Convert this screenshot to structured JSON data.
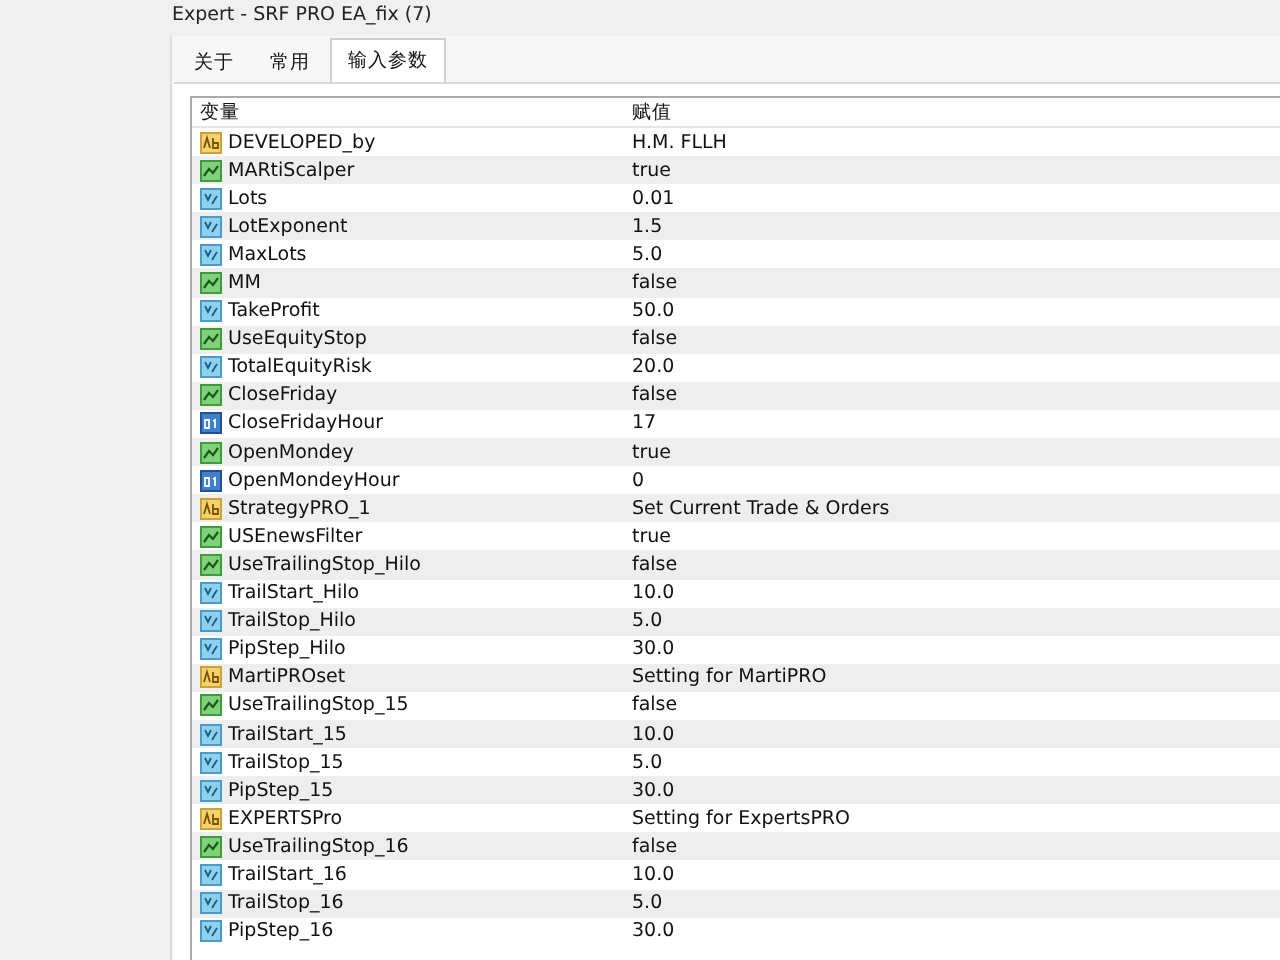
{
  "window": {
    "title": "Expert - SRF PRO EA_fix (7)"
  },
  "tabs": [
    {
      "label": "关于",
      "selected": false
    },
    {
      "label": "常用",
      "selected": false
    },
    {
      "label": "输入参数",
      "selected": true
    }
  ],
  "table": {
    "columns": [
      "变量",
      "赋值"
    ],
    "rows": [
      {
        "kind": "string",
        "name": "DEVELOPED_by",
        "value": "H.M. FLLH"
      },
      {
        "kind": "bool",
        "name": "MARtiScalper",
        "value": "true"
      },
      {
        "kind": "double",
        "name": "Lots",
        "value": "0.01"
      },
      {
        "kind": "double",
        "name": "LotExponent",
        "value": "1.5"
      },
      {
        "kind": "double",
        "name": "MaxLots",
        "value": "5.0"
      },
      {
        "kind": "bool",
        "name": "MM",
        "value": "false"
      },
      {
        "kind": "double",
        "name": "TakeProfit",
        "value": "50.0"
      },
      {
        "kind": "bool",
        "name": "UseEquityStop",
        "value": "false"
      },
      {
        "kind": "double",
        "name": "TotalEquityRisk",
        "value": "20.0"
      },
      {
        "kind": "bool",
        "name": "CloseFriday",
        "value": "false"
      },
      {
        "kind": "int",
        "name": "CloseFridayHour",
        "value": "17"
      },
      {
        "kind": "bool",
        "name": "OpenMondey",
        "value": "true"
      },
      {
        "kind": "int",
        "name": "OpenMondeyHour",
        "value": "0"
      },
      {
        "kind": "string",
        "name": "StrategyPRO_1",
        "value": "Set Current Trade & Orders"
      },
      {
        "kind": "bool",
        "name": "USEnewsFilter",
        "value": "true"
      },
      {
        "kind": "bool",
        "name": "UseTrailingStop_Hilo",
        "value": "false"
      },
      {
        "kind": "double",
        "name": "TrailStart_Hilo",
        "value": "10.0"
      },
      {
        "kind": "double",
        "name": "TrailStop_Hilo",
        "value": "5.0"
      },
      {
        "kind": "double",
        "name": "PipStep_Hilo",
        "value": "30.0"
      },
      {
        "kind": "string",
        "name": "MartiPROset",
        "value": "Setting for MartiPRO"
      },
      {
        "kind": "bool",
        "name": "UseTrailingStop_15",
        "value": "false"
      },
      {
        "kind": "double",
        "name": "TrailStart_15",
        "value": "10.0"
      },
      {
        "kind": "double",
        "name": "TrailStop_15",
        "value": "5.0"
      },
      {
        "kind": "double",
        "name": "PipStep_15",
        "value": "30.0"
      },
      {
        "kind": "string",
        "name": "EXPERTSPro",
        "value": "Setting for ExpertsPRO"
      },
      {
        "kind": "bool",
        "name": "UseTrailingStop_16",
        "value": "false"
      },
      {
        "kind": "double",
        "name": "TrailStart_16",
        "value": "10.0"
      },
      {
        "kind": "double",
        "name": "TrailStop_16",
        "value": "5.0"
      },
      {
        "kind": "double",
        "name": "PipStep_16",
        "value": "30.0"
      }
    ]
  }
}
